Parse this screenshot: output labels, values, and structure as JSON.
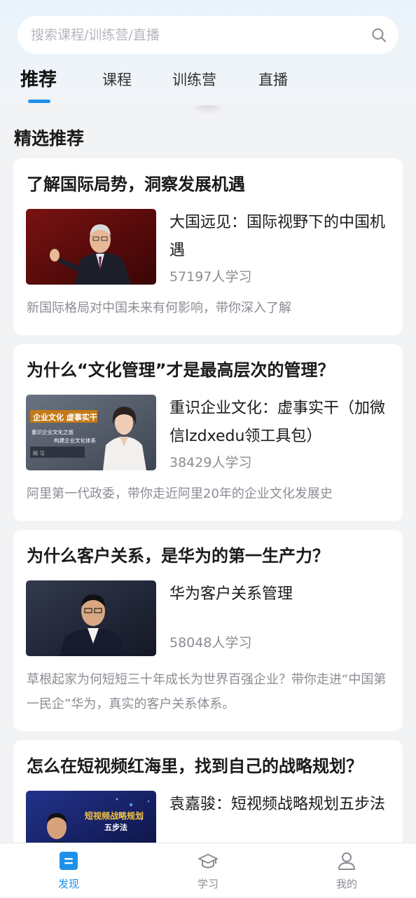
{
  "search": {
    "placeholder": "搜索课程/训练营/直播"
  },
  "tabs": [
    {
      "label": "推荐",
      "active": true
    },
    {
      "label": "课程",
      "active": false
    },
    {
      "label": "训练营",
      "active": false
    },
    {
      "label": "直播",
      "active": false
    }
  ],
  "section_title": "精选推荐",
  "cards": [
    {
      "title": "了解国际局势，洞察发展机遇",
      "course_name": "大国远见：国际视野下的中国机遇",
      "learners": "57197人学习",
      "description": "新国际格局对中国未来有何影响，带你深入了解",
      "thumb_colors": [
        "#6e0f0f",
        "#3a0505"
      ]
    },
    {
      "title": "为什么“文化管理”才是最高层次的管理？",
      "course_name": "重识企业文化：虚事实干（加微信lzdxedu领工具包）",
      "learners": "38429人学习",
      "description": "阿里第一代政委，带你走近阿里20年的企业文化发展史",
      "thumb_colors": [
        "#5c6472",
        "#3a414d"
      ],
      "thumb_text": {
        "badge": "企业文化 虚事实干",
        "line1": "重识企业文化之旅",
        "line2": "构建企业文化体系",
        "tag": "同 习"
      }
    },
    {
      "title": "为什么客户关系，是华为的第一生产力？",
      "course_name": "华为客户关系管理",
      "learners": "58048人学习",
      "description": "草根起家为何短短三十年成长为世界百强企业？带你走进“中国第一民企”华为，真实的客户关系体系。",
      "thumb_colors": [
        "#2c3244",
        "#151a27"
      ]
    },
    {
      "title": "怎么在短视频红海里，找到自己的战略规划？",
      "course_name": "袁嘉骏：短视频战略规划五步法",
      "learners": "",
      "description": "",
      "thumb_colors": [
        "#1b2a7a",
        "#0d1442"
      ],
      "thumb_text": {
        "line1": "短视频战略规划",
        "line2": "五步法"
      }
    }
  ],
  "bottom_nav": [
    {
      "label": "发现",
      "icon": "discover-icon",
      "active": true
    },
    {
      "label": "学习",
      "icon": "graduation-cap-icon",
      "active": false
    },
    {
      "label": "我的",
      "icon": "user-icon",
      "active": false
    }
  ],
  "colors": {
    "accent": "#1e90e8",
    "muted_text": "#8a8d93",
    "background": "#f2f3f5"
  }
}
